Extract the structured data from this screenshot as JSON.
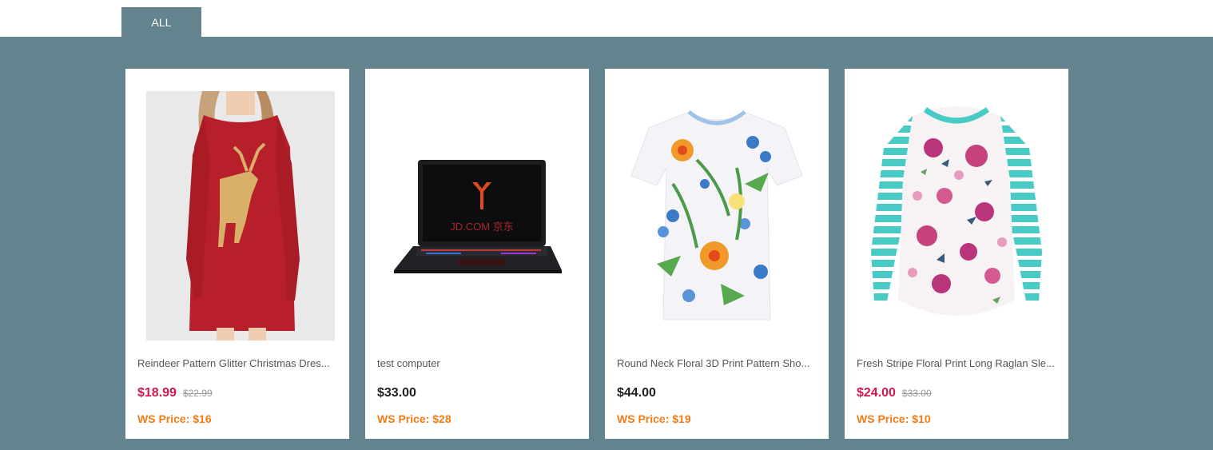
{
  "tabs": [
    {
      "label": "ALL"
    }
  ],
  "colors": {
    "panel": "#63838f",
    "sale_price": "#d0184f",
    "regular_price": "#222222",
    "ws_price": "#f07c17"
  },
  "products": [
    {
      "title": "Reindeer Pattern Glitter Christmas Dres...",
      "price": "$18.99",
      "old_price": "$22.99",
      "ws_price": "WS Price: $16",
      "image": "red-reindeer-dress-image"
    },
    {
      "title": "test computer",
      "price": "$33.00",
      "old_price": "",
      "ws_price": "WS Price: $28",
      "image": "laptop-image",
      "image_text": "JD.COM 京东"
    },
    {
      "title": "Round Neck Floral 3D Print Pattern Sho...",
      "price": "$44.00",
      "old_price": "",
      "ws_price": "WS Price: $19",
      "image": "floral-tshirt-image"
    },
    {
      "title": "Fresh Stripe Floral Print Long Raglan Sle...",
      "price": "$24.00",
      "old_price": "$33.00",
      "ws_price": "WS Price: $10",
      "image": "striped-floral-shirt-image"
    }
  ]
}
